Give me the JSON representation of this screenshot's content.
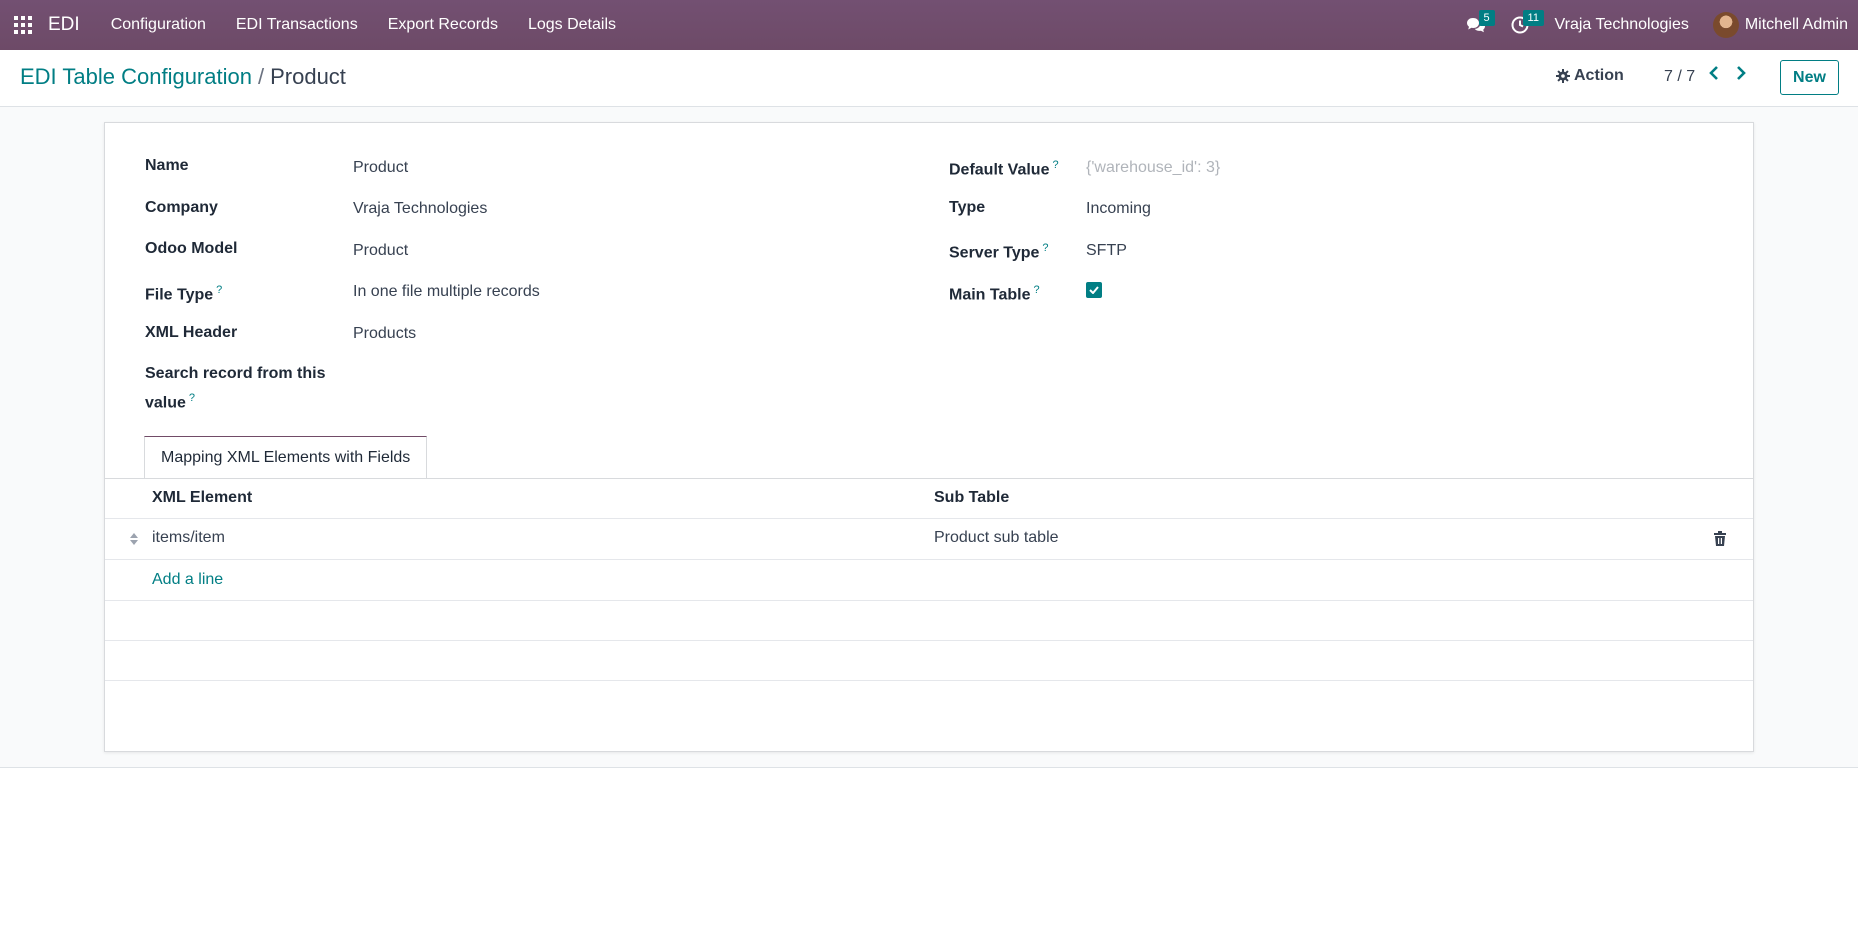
{
  "navbar": {
    "brand": "EDI",
    "menu": [
      "Configuration",
      "EDI Transactions",
      "Export Records",
      "Logs Details"
    ],
    "messages_count": "5",
    "activities_count": "11",
    "company": "Vraja Technologies",
    "user": "Mitchell Admin"
  },
  "breadcrumb": {
    "parent": "EDI Table Configuration",
    "separator": "/",
    "current": "Product"
  },
  "control": {
    "action_label": "Action",
    "pager": "7 / 7",
    "new_label": "New"
  },
  "form": {
    "left": [
      {
        "label": "Name",
        "value": "Product",
        "help": ""
      },
      {
        "label": "Company",
        "value": "Vraja Technologies",
        "help": ""
      },
      {
        "label": "Odoo Model",
        "value": "Product",
        "help": ""
      },
      {
        "label": "File Type",
        "value": "In one file multiple records",
        "help": "?"
      },
      {
        "label": "XML Header",
        "value": "Products",
        "help": ""
      },
      {
        "label_line1": "Search record from this",
        "label_line2": "value",
        "value": "",
        "help": "?"
      }
    ],
    "right": [
      {
        "label": "Default Value",
        "placeholder": "{'warehouse_id': 3}",
        "help": "?"
      },
      {
        "label": "Type",
        "value": "Incoming",
        "help": ""
      },
      {
        "label": "Server Type",
        "value": "SFTP",
        "help": "?"
      },
      {
        "label": "Main Table",
        "checked": true,
        "help": "?"
      }
    ]
  },
  "notebook": {
    "tab_label": "Mapping XML Elements with Fields",
    "columns": [
      "XML Element",
      "Sub Table"
    ],
    "rows": [
      {
        "xml_element": "items/item",
        "sub_table": "Product sub table"
      }
    ],
    "add_line": "Add a line"
  }
}
